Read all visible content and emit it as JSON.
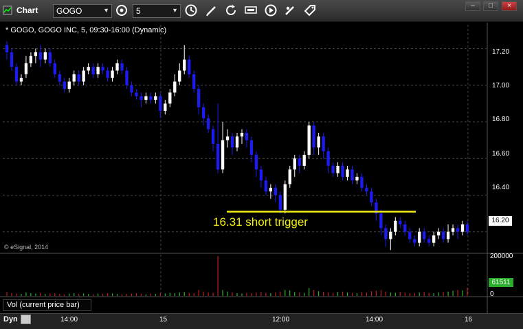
{
  "window": {
    "title": "Chart",
    "symbol": "GOGO",
    "interval": "5",
    "minimize": "–",
    "maximize": "□",
    "close": "×"
  },
  "toolbar": {
    "icons": [
      "clock-sync-icon",
      "clock-icon",
      "pencil-icon",
      "refresh-icon",
      "quote-icon",
      "play-icon",
      "pen-alert-icon",
      "tag-icon"
    ]
  },
  "chart": {
    "legend": "* GOGO, GOGO INC, 5, 09:30-16:00 (Dynamic)",
    "copyright": "© eSignal, 2014",
    "current_price": "16.20",
    "annotation": "16.31 short trigger",
    "price_axis": [
      "17.20",
      "17.00",
      "16.80",
      "16.60",
      "16.40",
      "16.20"
    ],
    "volume_axis": [
      "200000",
      "0"
    ],
    "current_volume": "61511",
    "volume_legend": "Vol (current price bar)",
    "dyn_label": "Dyn",
    "time_axis": [
      "14:00",
      "15",
      "12:00",
      "14:00",
      "16"
    ],
    "colors": {
      "up": "#ffffff",
      "down": "#1c1cf0",
      "trigger": "#f2ee14",
      "vol_up": "#2ab52a",
      "vol_down": "#c02020"
    }
  },
  "chart_data": {
    "type": "candlestick",
    "trigger_level": 16.31,
    "ylim": [
      16.09,
      17.33
    ],
    "candles": [
      [
        17.22,
        17.18,
        17.24,
        17.14
      ],
      [
        17.18,
        17.1,
        17.2,
        17.08
      ],
      [
        17.1,
        17.02,
        17.12,
        17.0
      ],
      [
        17.02,
        17.04,
        17.06,
        17.0
      ],
      [
        17.06,
        17.12,
        17.16,
        17.04
      ],
      [
        17.12,
        17.16,
        17.18,
        17.1
      ],
      [
        17.16,
        17.18,
        17.2,
        17.12
      ],
      [
        17.18,
        17.14,
        17.22,
        17.1
      ],
      [
        17.14,
        17.18,
        17.2,
        17.12
      ],
      [
        17.18,
        17.12,
        17.2,
        17.1
      ],
      [
        17.12,
        17.06,
        17.14,
        17.04
      ],
      [
        17.06,
        17.02,
        17.08,
        17.0
      ],
      [
        17.02,
        16.98,
        17.04,
        16.96
      ],
      [
        16.98,
        17.02,
        17.04,
        16.96
      ],
      [
        17.02,
        17.06,
        17.08,
        17.0
      ],
      [
        17.06,
        17.02,
        17.08,
        17.0
      ],
      [
        17.02,
        17.08,
        17.1,
        17.0
      ],
      [
        17.08,
        17.1,
        17.12,
        17.06
      ],
      [
        17.1,
        17.06,
        17.12,
        17.04
      ],
      [
        17.06,
        17.1,
        17.12,
        17.04
      ],
      [
        17.1,
        17.08,
        17.12,
        17.06
      ],
      [
        17.08,
        17.04,
        17.1,
        17.02
      ],
      [
        17.04,
        17.08,
        17.1,
        17.02
      ],
      [
        17.08,
        17.12,
        17.14,
        17.06
      ],
      [
        17.12,
        17.08,
        17.14,
        17.06
      ],
      [
        17.08,
        17.0,
        17.1,
        16.98
      ],
      [
        17.0,
        16.96,
        17.02,
        16.94
      ],
      [
        16.96,
        16.94,
        16.98,
        16.92
      ],
      [
        16.94,
        16.92,
        16.96,
        16.88
      ],
      [
        16.92,
        16.94,
        16.96,
        16.9
      ],
      [
        16.94,
        16.92,
        16.96,
        16.9
      ],
      [
        16.92,
        16.94,
        16.96,
        16.9
      ],
      [
        16.94,
        16.86,
        16.96,
        16.82
      ],
      [
        16.86,
        16.9,
        16.92,
        16.84
      ],
      [
        16.9,
        16.96,
        16.98,
        16.88
      ],
      [
        16.96,
        17.02,
        17.06,
        16.94
      ],
      [
        17.02,
        17.08,
        17.12,
        17.0
      ],
      [
        17.08,
        17.14,
        17.22,
        17.06
      ],
      [
        17.14,
        17.06,
        17.16,
        17.04
      ],
      [
        17.06,
        16.98,
        17.08,
        16.96
      ],
      [
        16.98,
        16.88,
        17.0,
        16.84
      ],
      [
        16.88,
        16.82,
        16.9,
        16.78
      ],
      [
        16.82,
        16.76,
        16.84,
        16.74
      ],
      [
        16.76,
        16.68,
        16.78,
        16.64
      ],
      [
        16.68,
        16.54,
        16.9,
        16.52
      ],
      [
        16.54,
        16.7,
        16.8,
        16.52
      ],
      [
        16.7,
        16.72,
        16.76,
        16.66
      ],
      [
        16.72,
        16.66,
        16.74,
        16.62
      ],
      [
        16.66,
        16.72,
        16.74,
        16.64
      ],
      [
        16.72,
        16.74,
        16.76,
        16.68
      ],
      [
        16.74,
        16.7,
        16.76,
        16.66
      ],
      [
        16.7,
        16.62,
        16.72,
        16.58
      ],
      [
        16.62,
        16.54,
        16.64,
        16.5
      ],
      [
        16.54,
        16.48,
        16.56,
        16.44
      ],
      [
        16.48,
        16.42,
        16.5,
        16.4
      ],
      [
        16.42,
        16.44,
        16.46,
        16.38
      ],
      [
        16.44,
        16.4,
        16.46,
        16.36
      ],
      [
        16.4,
        16.32,
        16.42,
        16.3
      ],
      [
        16.32,
        16.46,
        16.48,
        16.3
      ],
      [
        16.46,
        16.54,
        16.56,
        16.44
      ],
      [
        16.54,
        16.6,
        16.62,
        16.5
      ],
      [
        16.6,
        16.56,
        16.62,
        16.52
      ],
      [
        16.56,
        16.62,
        16.64,
        16.54
      ],
      [
        16.62,
        16.78,
        16.8,
        16.6
      ],
      [
        16.78,
        16.66,
        16.8,
        16.62
      ],
      [
        16.66,
        16.72,
        16.74,
        16.62
      ],
      [
        16.72,
        16.64,
        16.74,
        16.6
      ],
      [
        16.64,
        16.56,
        16.66,
        16.52
      ],
      [
        16.56,
        16.52,
        16.58,
        16.5
      ],
      [
        16.52,
        16.56,
        16.58,
        16.5
      ],
      [
        16.56,
        16.5,
        16.58,
        16.48
      ],
      [
        16.5,
        16.54,
        16.56,
        16.48
      ],
      [
        16.54,
        16.48,
        16.56,
        16.46
      ],
      [
        16.48,
        16.5,
        16.52,
        16.46
      ],
      [
        16.5,
        16.44,
        16.52,
        16.42
      ],
      [
        16.44,
        16.42,
        16.46,
        16.4
      ],
      [
        16.42,
        16.36,
        16.44,
        16.34
      ],
      [
        16.36,
        16.3,
        16.38,
        16.26
      ],
      [
        16.3,
        16.22,
        16.32,
        16.18
      ],
      [
        16.22,
        16.16,
        16.24,
        16.12
      ],
      [
        16.16,
        16.2,
        16.22,
        16.1
      ],
      [
        16.2,
        16.26,
        16.28,
        16.18
      ],
      [
        16.26,
        16.24,
        16.28,
        16.22
      ],
      [
        16.24,
        16.2,
        16.26,
        16.18
      ],
      [
        16.2,
        16.16,
        16.22,
        16.14
      ],
      [
        16.16,
        16.14,
        16.18,
        16.12
      ],
      [
        16.14,
        16.2,
        16.22,
        16.12
      ],
      [
        16.2,
        16.16,
        16.22,
        16.14
      ],
      [
        16.16,
        16.14,
        16.18,
        16.12
      ],
      [
        16.14,
        16.18,
        16.2,
        16.12
      ],
      [
        16.18,
        16.2,
        16.22,
        16.16
      ],
      [
        16.2,
        16.16,
        16.22,
        16.14
      ],
      [
        16.16,
        16.2,
        16.24,
        16.14
      ],
      [
        16.2,
        16.22,
        16.24,
        16.18
      ],
      [
        16.22,
        16.2,
        16.24,
        16.16
      ],
      [
        16.2,
        16.24,
        16.26,
        16.18
      ],
      [
        16.24,
        16.2,
        16.26,
        16.18
      ]
    ],
    "volume": [
      20,
      15,
      12,
      10,
      18,
      14,
      12,
      16,
      10,
      12,
      14,
      10,
      8,
      12,
      14,
      10,
      12,
      10,
      8,
      12,
      10,
      14,
      12,
      10,
      8,
      10,
      12,
      14,
      10,
      8,
      12,
      10,
      14,
      12,
      16,
      14,
      18,
      20,
      16,
      14,
      30,
      22,
      18,
      16,
      200,
      30,
      22,
      18,
      14,
      12,
      16,
      14,
      18,
      20,
      16,
      14,
      18,
      22,
      30,
      28,
      20,
      18,
      16,
      40,
      30,
      24,
      20,
      18,
      16,
      20,
      22,
      18,
      16,
      14,
      20,
      18,
      24,
      26,
      30,
      22,
      18,
      16,
      20,
      18,
      14,
      16,
      18,
      20,
      16,
      14,
      18,
      20,
      22,
      26,
      30,
      28,
      40
    ]
  }
}
